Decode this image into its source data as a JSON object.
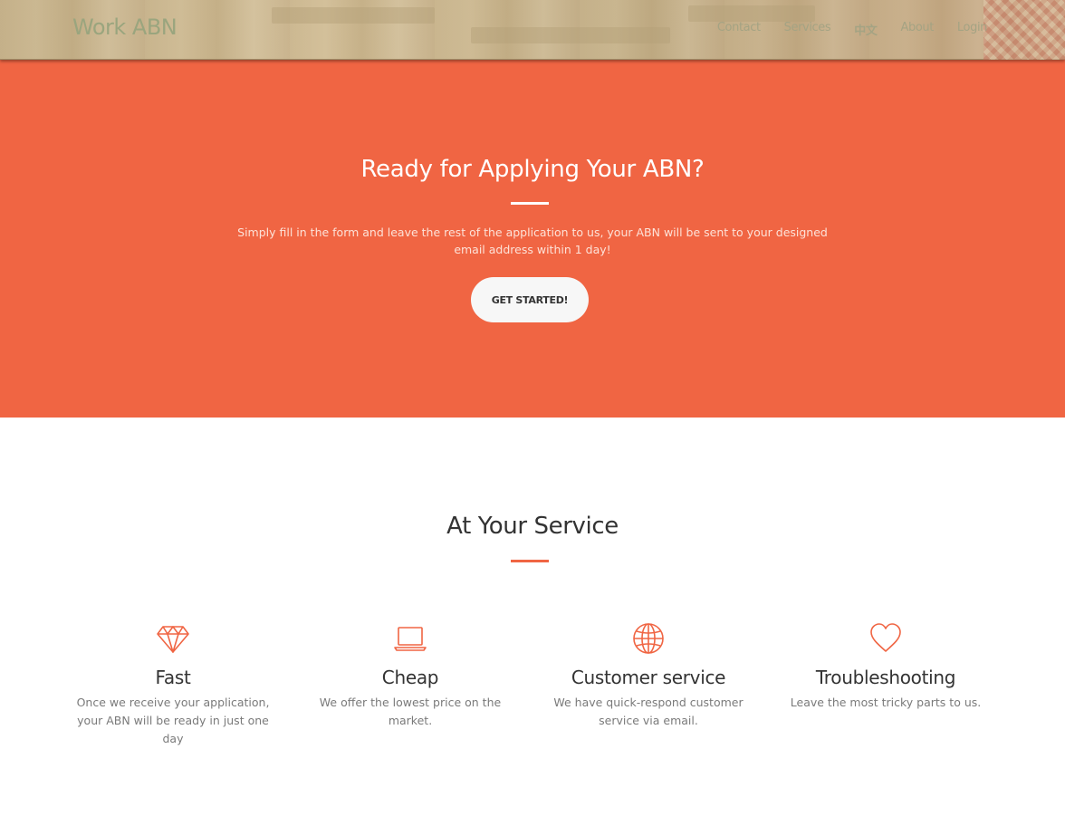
{
  "navbar": {
    "brand": "Work ABN",
    "links": [
      {
        "label": "Contact"
      },
      {
        "label": "Services"
      },
      {
        "label": "中文"
      },
      {
        "label": "About"
      },
      {
        "label": "Login"
      }
    ]
  },
  "hero": {
    "title": "Ready for Applying Your ABN?",
    "text": "Simply fill in the form and leave the rest of the application to us, your ABN will be sent to your designed email address within 1 day!",
    "button_label": "GET STARTED!",
    "background_color": "#f06543"
  },
  "services": {
    "title": "At Your Service",
    "accent_color": "#f06543",
    "items": [
      {
        "icon": "diamond-icon",
        "name": "Fast",
        "desc": "Once we receive your application, your ABN will be ready in just one day"
      },
      {
        "icon": "laptop-icon",
        "name": "Cheap",
        "desc": "We offer the lowest price on the market."
      },
      {
        "icon": "globe-icon",
        "name": "Customer service",
        "desc": "We have quick-respond customer service via email."
      },
      {
        "icon": "heart-icon",
        "name": "Troubleshooting",
        "desc": "Leave the most tricky parts to us."
      }
    ]
  }
}
